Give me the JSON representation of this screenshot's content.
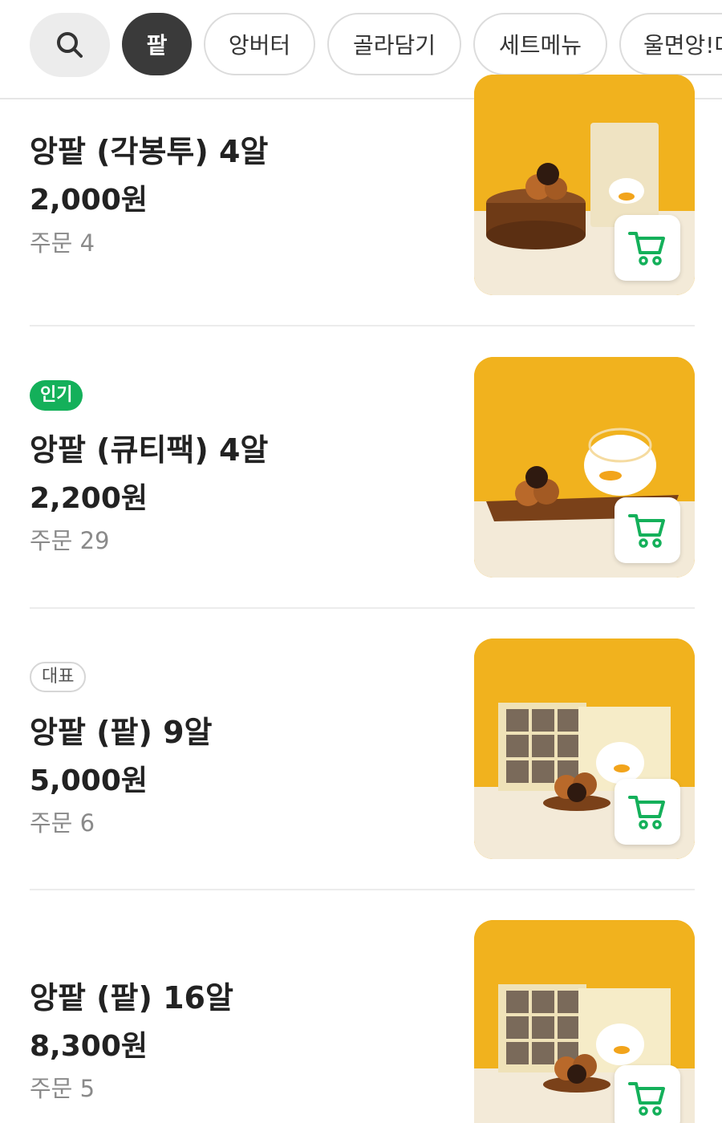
{
  "categories": [
    {
      "label": "팥",
      "active": true
    },
    {
      "label": "앙버터",
      "active": false
    },
    {
      "label": "골라담기",
      "active": false
    },
    {
      "label": "세트메뉴",
      "active": false
    },
    {
      "label": "울면앙!대",
      "active": false
    }
  ],
  "order_prefix": "주문",
  "products": [
    {
      "badge": "",
      "name": "앙팥 (각봉투) 4알",
      "price": "2,000원",
      "orders": "4"
    },
    {
      "badge": "인기",
      "name": "앙팥 (큐티팩) 4알",
      "price": "2,200원",
      "orders": "29"
    },
    {
      "badge": "대표",
      "name": "앙팥 (팥) 9알",
      "price": "5,000원",
      "orders": "6"
    },
    {
      "badge": "",
      "name": "앙팥 (팥) 16알",
      "price": "8,300원",
      "orders": "5"
    }
  ],
  "colors": {
    "accent_green": "#14b05a",
    "chip_active": "#3a3a3a",
    "photo_bg": "#f1b21e"
  },
  "icons": {
    "search": "search-icon",
    "cart": "cart-icon"
  }
}
